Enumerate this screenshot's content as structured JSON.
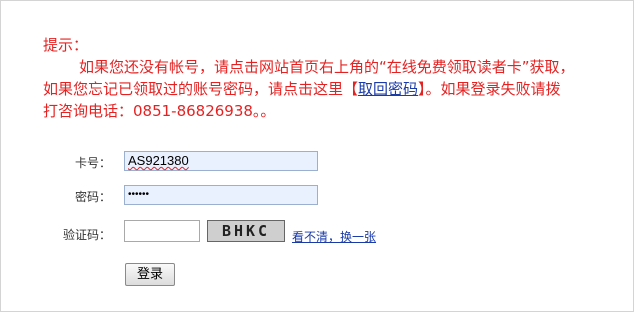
{
  "notice": {
    "title": "提示：",
    "line1": "如果您还没有帐号，请点击网站首页右上角的“在线免费领取读者卡”获取，",
    "line2_pre": "如果您忘记已领取过的账号密码，请点击这里【",
    "line2_link": "取回密码",
    "line2_post": "】。如果登录失败请拨",
    "line3": "打咨询电话：0851-86826938。。"
  },
  "form": {
    "card_label": "卡号：",
    "card_value": "AS921380",
    "password_label": "密码：",
    "password_value": "••••••",
    "captcha_label": "验证码：",
    "captcha_value": "",
    "captcha_image_text": "BHKC",
    "refresh_link": "看不清，换一张",
    "login_button": "登录"
  }
}
